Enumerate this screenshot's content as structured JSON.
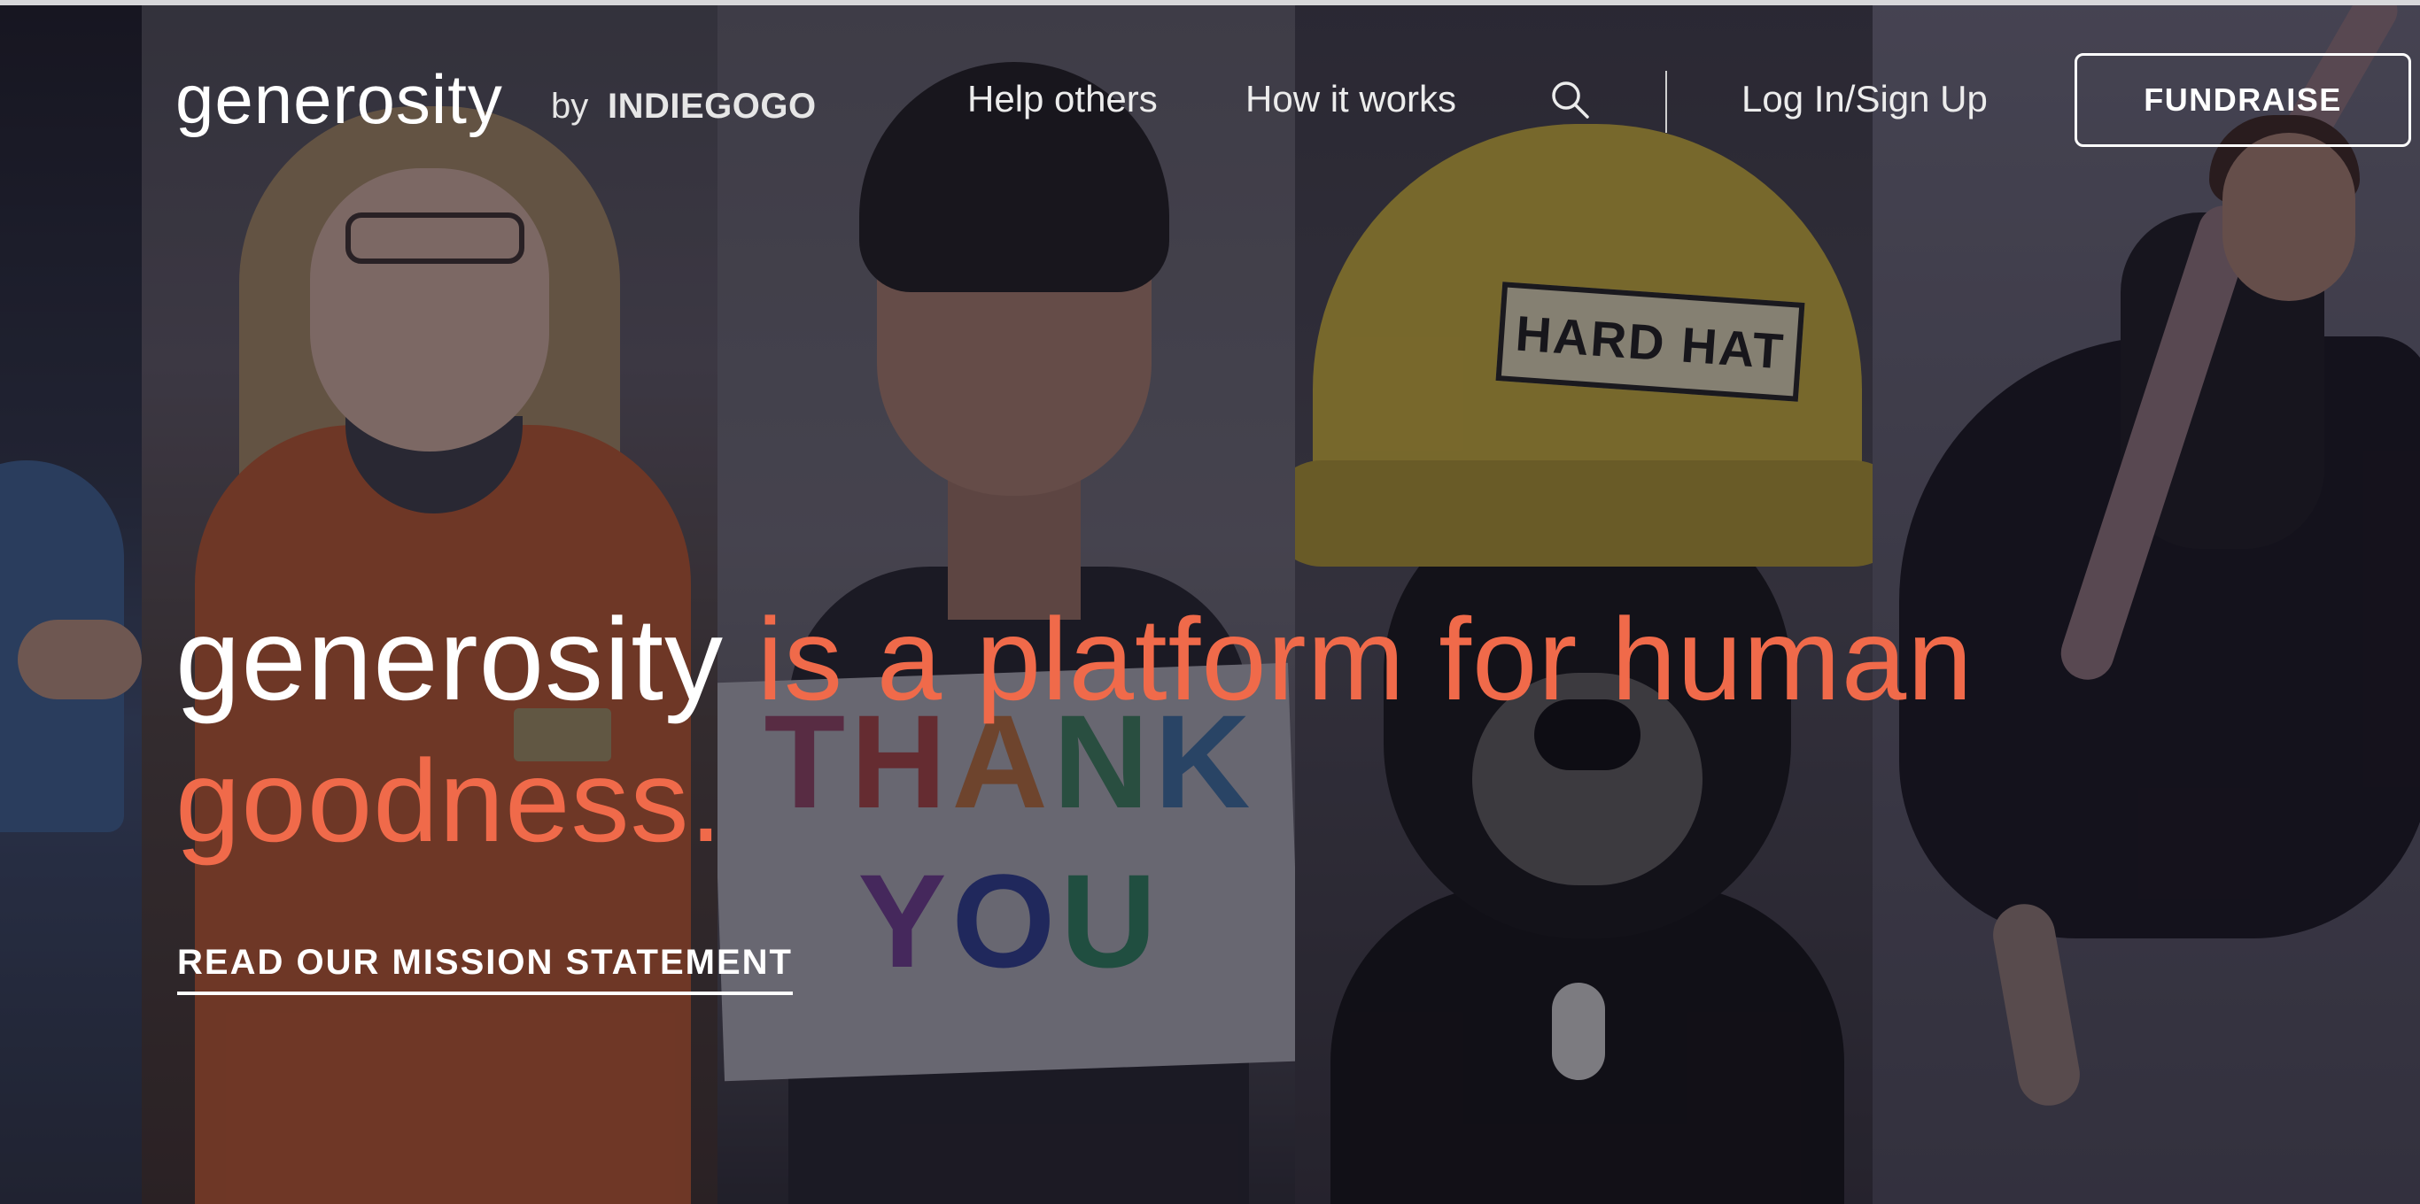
{
  "header": {
    "logo_word": "generosity",
    "logo_by": "by",
    "logo_brand": "INDIEGOGO",
    "nav": {
      "help_others": "Help others",
      "how_it_works": "How it works",
      "search_icon": "search-icon",
      "login": "Log In/Sign Up"
    },
    "fundraise_label": "FUNDRAISE"
  },
  "hero": {
    "headline_brand": "generosity",
    "headline_rest_line1": " is a platform for human",
    "headline_rest_line2": "goodness.",
    "cta_label": "READ OUR MISSION STATEMENT",
    "accent_color": "#f06a4a",
    "photo_texts": {
      "sign_line1": "THANK",
      "sign_line2": "YOU",
      "hard_hat_label": "HARD HAT"
    }
  }
}
